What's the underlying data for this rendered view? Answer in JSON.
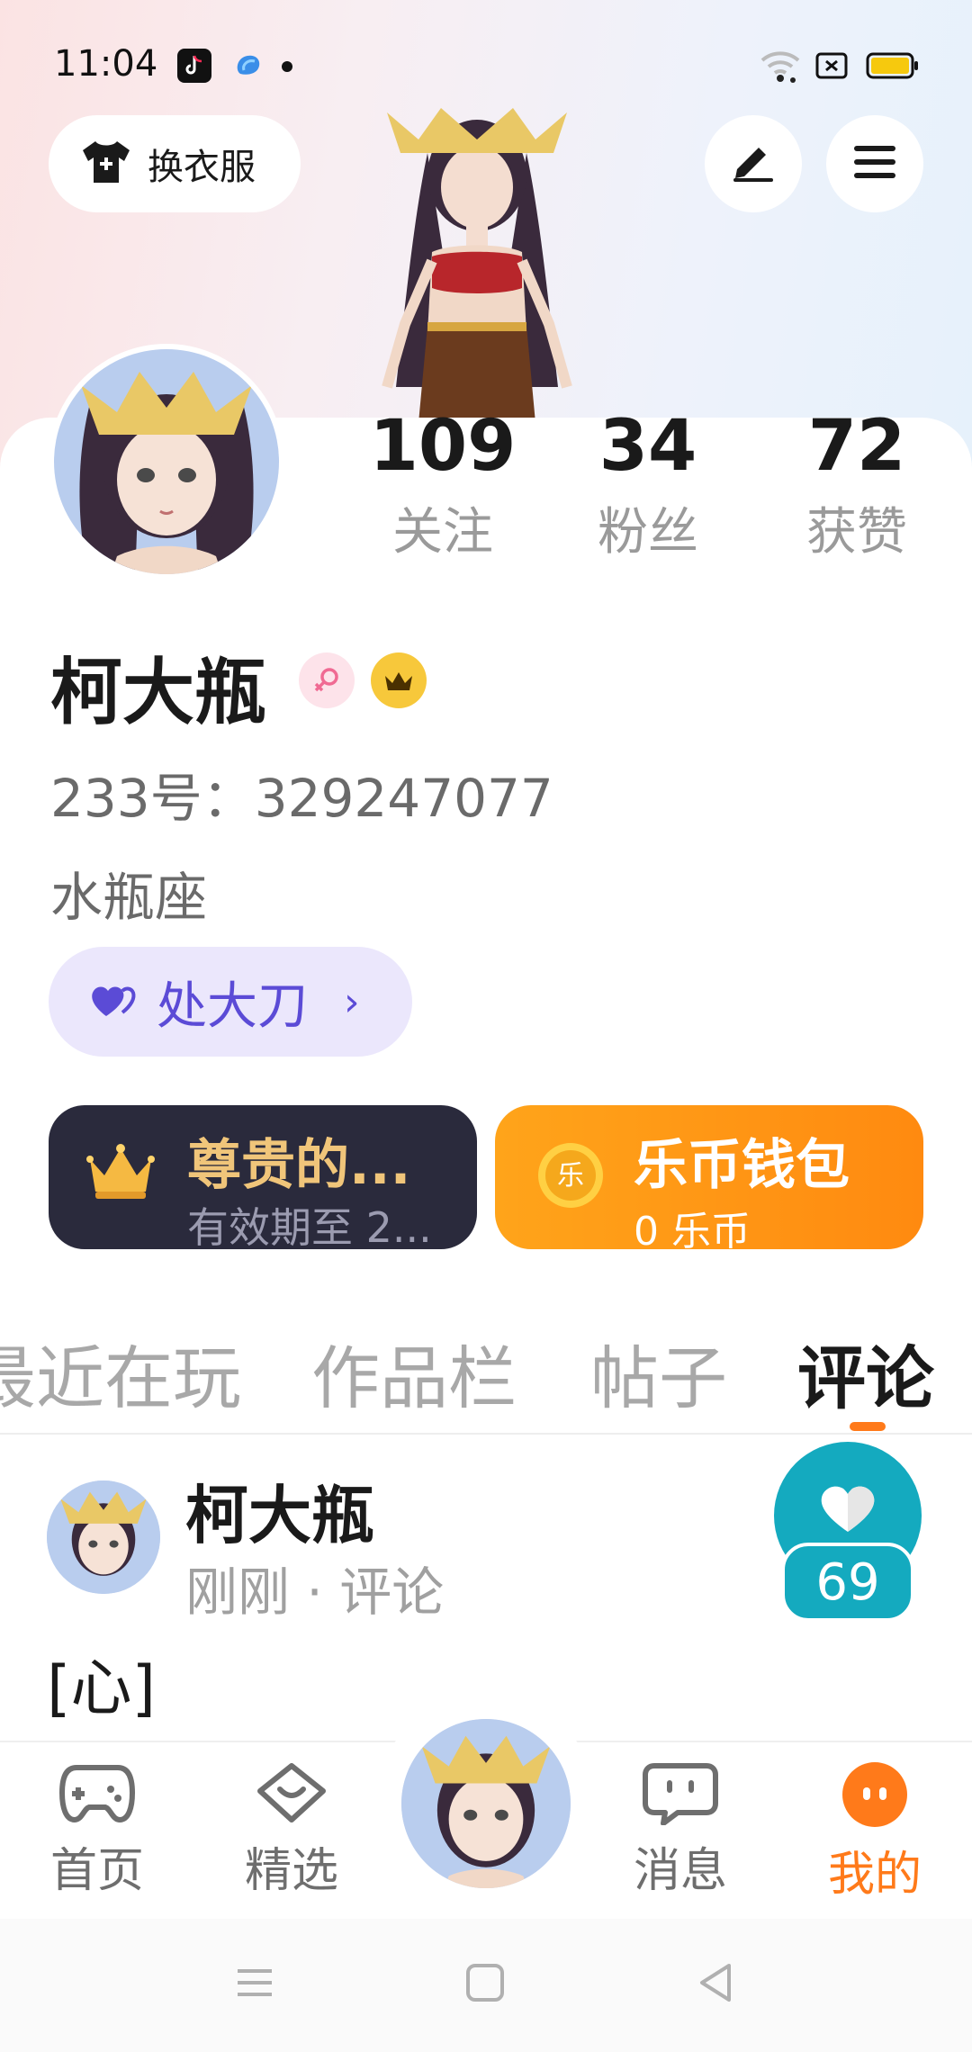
{
  "status_bar": {
    "time": "11:04"
  },
  "header": {
    "outfit_label": "换衣服",
    "edit_icon": "pen-icon",
    "menu_icon": "menu-icon"
  },
  "profile": {
    "username": "柯大瓶",
    "account_id": "233号：329247077",
    "zodiac": "水瓶座",
    "tag_label": "处大刀",
    "stats": [
      {
        "value": "109",
        "label": "关注"
      },
      {
        "value": "34",
        "label": "粉丝"
      },
      {
        "value": "72",
        "label": "获赞"
      }
    ]
  },
  "vip_card": {
    "title": "尊贵的...",
    "subtitle": "有效期至 2..."
  },
  "wallet_card": {
    "title": "乐币钱包",
    "subtitle": "0 乐币",
    "coin_glyph": "乐"
  },
  "tabs": [
    {
      "label": "最近在玩"
    },
    {
      "label": "作品栏"
    },
    {
      "label": "帖子"
    },
    {
      "label": "评论"
    }
  ],
  "active_tab": "评论",
  "comment": {
    "author": "柯大瓶",
    "meta": "刚刚 · 评论",
    "text": "[心]",
    "like_count": "69"
  },
  "bottom_nav": {
    "items": [
      {
        "label": "首页",
        "icon": "gamepad-icon"
      },
      {
        "label": "精选",
        "icon": "heart-chat-icon"
      },
      {
        "label": "消息",
        "icon": "message-icon"
      },
      {
        "label": "我的",
        "icon": "mine-icon"
      }
    ]
  },
  "colors": {
    "accent": "#ff7a1a",
    "tag_text": "#5b4bd6",
    "tag_bg": "#ebe7fc",
    "vip_bg": "#2a2a3c",
    "vip_gold": "#f0c57a",
    "like_teal": "#14aabf"
  }
}
